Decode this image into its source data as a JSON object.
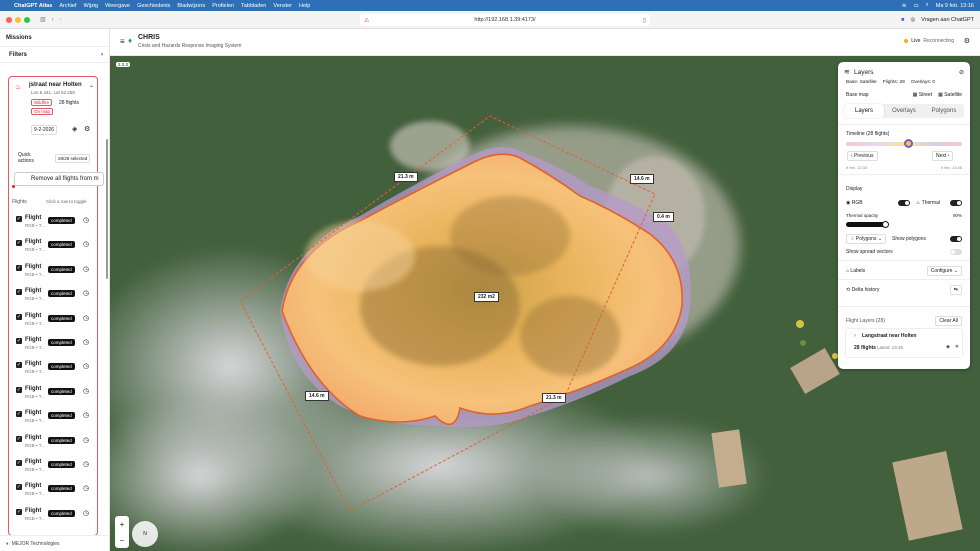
{
  "menubar": {
    "app": "ChatGPT Atlas",
    "items": [
      "Archief",
      "Wijzig",
      "Weergave",
      "Geschiedenis",
      "Bladwijzers",
      "Profielen",
      "Tabbladen",
      "Venster",
      "Help"
    ],
    "clock": "Ma 9 feb. 13:16"
  },
  "browser": {
    "url": "http://192.168.1.39:4173/",
    "ask_label": "Vragen aan ChatGPT"
  },
  "sidebar": {
    "title": "Missions",
    "filters_label": "Filters",
    "mission": {
      "name": "Langstraat near Holten",
      "name_visible": "jstraat near Holten",
      "location": "Lon 6.441, Lat 52.259",
      "tag_type": "Wildfire",
      "tag_status": "On map",
      "flights": "28 flights",
      "date": "9-2-2026"
    },
    "quick_actions": "Quick actions",
    "selected": "28/28 selected",
    "remove_all": "Remove all flights from m",
    "flights_label": "Flights",
    "flights_hint": "Click a row to toggle",
    "flight_rows": [
      {
        "name": "Flight",
        "sub": "RGB • T...",
        "status": "completed"
      },
      {
        "name": "Flight",
        "sub": "RGB • T...",
        "status": "completed"
      },
      {
        "name": "Flight",
        "sub": "RGB • T...",
        "status": "completed"
      },
      {
        "name": "Flight",
        "sub": "RGB • T...",
        "status": "completed"
      },
      {
        "name": "Flight",
        "sub": "RGB • T...",
        "status": "completed"
      },
      {
        "name": "Flight",
        "sub": "RGB • T...",
        "status": "completed"
      },
      {
        "name": "Flight",
        "sub": "RGB • T...",
        "status": "completed"
      },
      {
        "name": "Flight",
        "sub": "RGB • T...",
        "status": "completed"
      },
      {
        "name": "Flight",
        "sub": "RGB • T...",
        "status": "completed"
      },
      {
        "name": "Flight",
        "sub": "RGB • T...",
        "status": "completed"
      },
      {
        "name": "Flight",
        "sub": "RGB • T...",
        "status": "completed"
      },
      {
        "name": "Flight",
        "sub": "RGB • T...",
        "status": "completed"
      },
      {
        "name": "Flight",
        "sub": "RGB • T...",
        "status": "completed"
      }
    ],
    "footer": "MEJOR Technologies"
  },
  "header": {
    "title": "CHRIS",
    "subtitle": "Crisis and Hazards Response Imaging System",
    "live": "Live",
    "reconnecting": "Reconnecting"
  },
  "map": {
    "zoom_badge": "2.2.3",
    "measurements": {
      "m1": "21.3 m",
      "m2": "14.6 m",
      "m3": "0.4 m",
      "area": "232 m2",
      "m4": "14.6 m",
      "m5": "21.3 m"
    },
    "zoom_in": "+",
    "zoom_out": "−",
    "compass": "N"
  },
  "layers_panel": {
    "title": "Layers",
    "base": "Base: Satellite",
    "flights": "Flights: 28",
    "overlays": "Overlays: 0",
    "base_map": "Base map",
    "street": "Street",
    "satellite": "Satellite",
    "tabs": [
      "Layers",
      "Overlays",
      "Polygons"
    ],
    "timeline": "Timeline (28 flights)",
    "previous": "Previous",
    "next": "Next",
    "time_start": "9 feb. 13:33",
    "time_end": "9 feb. 13:46",
    "display": "Display",
    "rgb": "RGB",
    "thermal": "Thermal",
    "thermal_opacity": "Thermal opacity",
    "opacity_value": "90%",
    "polygons": "Polygons",
    "show_polygons": "Show polygons",
    "show_spread": "Show spread vectors",
    "labels": "Labels",
    "configure": "Configure",
    "delta": "Delta history",
    "flight_layers": "Flight Layers (28)",
    "clear_all": "Clear All",
    "group_name": "Langstraat near Holten",
    "group_flights": "28 flights",
    "group_latest": "Latest: 13:46"
  }
}
